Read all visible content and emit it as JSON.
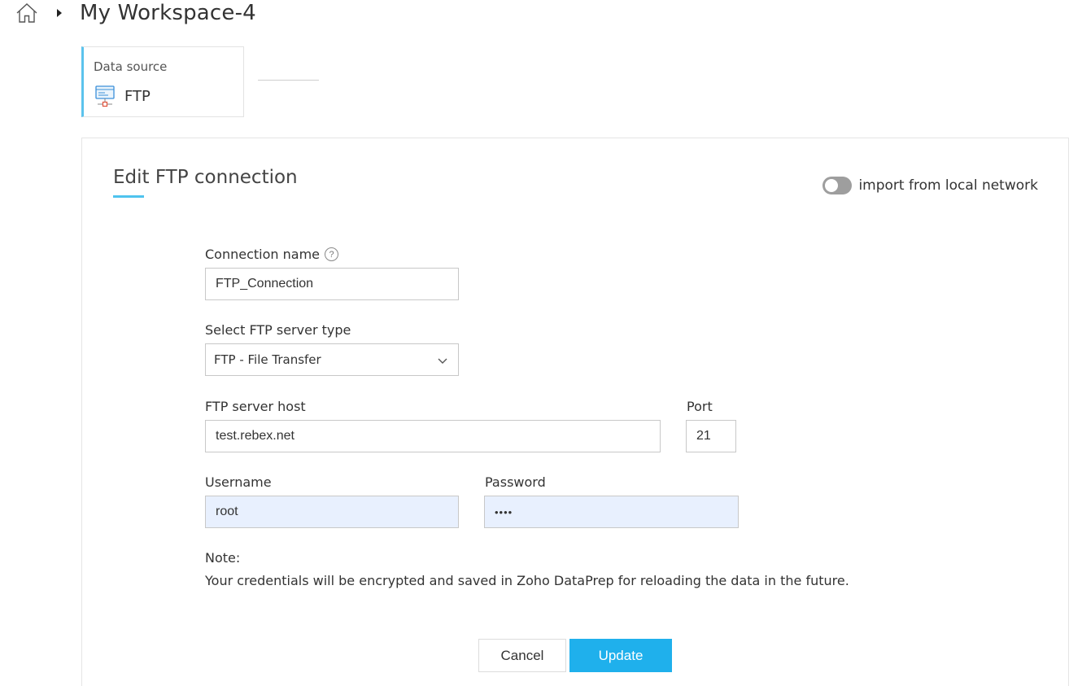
{
  "breadcrumb": {
    "workspace_title": "My Workspace-4"
  },
  "data_source": {
    "label": "Data source",
    "name": "FTP",
    "icon": "ftp-server-icon"
  },
  "form": {
    "title": "Edit FTP connection",
    "toggle": {
      "label": "import from local network",
      "enabled": false
    },
    "connection_name": {
      "label": "Connection name",
      "value": "FTP_Connection",
      "help_icon": "?"
    },
    "server_type": {
      "label": "Select FTP server type",
      "selected": "FTP - File Transfer"
    },
    "host": {
      "label": "FTP server host",
      "value": "test.rebex.net"
    },
    "port": {
      "label": "Port",
      "value": "21"
    },
    "username": {
      "label": "Username",
      "value": "root"
    },
    "password": {
      "label": "Password",
      "value": "••••"
    },
    "note": {
      "heading": "Note:",
      "text": "Your credentials will be encrypted and saved in Zoho DataPrep for reloading the data in the future."
    },
    "buttons": {
      "cancel": "Cancel",
      "update": "Update"
    }
  },
  "colors": {
    "accent": "#1fb0ec",
    "underline": "#4fc3ee",
    "autofill_bg": "#e8f0fe",
    "toggle_off": "#9e9e9e"
  }
}
